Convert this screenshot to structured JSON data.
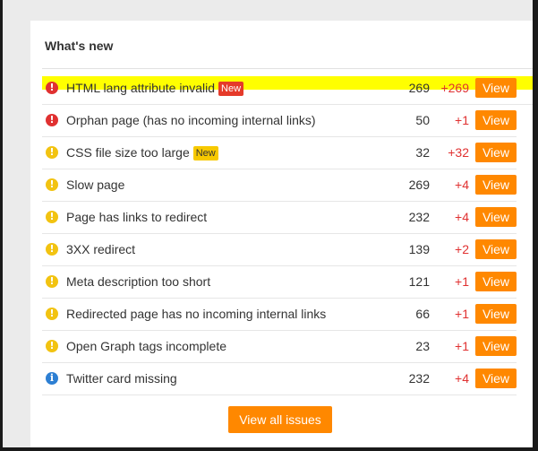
{
  "panel": {
    "title": "What's new"
  },
  "issues": [
    {
      "severity": "error",
      "icon": "!",
      "name": "HTML lang attribute invalid",
      "badge": "New",
      "badge_color": "red",
      "count": "269",
      "delta": "+269",
      "view_label": "View",
      "highlighted": true
    },
    {
      "severity": "error",
      "icon": "!",
      "name": "Orphan page (has no incoming internal links)",
      "badge": "",
      "count": "50",
      "delta": "+1",
      "view_label": "View"
    },
    {
      "severity": "warning",
      "icon": "!",
      "name": "CSS file size too large",
      "badge": "New",
      "badge_color": "yellow",
      "count": "32",
      "delta": "+32",
      "view_label": "View"
    },
    {
      "severity": "warning",
      "icon": "!",
      "name": "Slow page",
      "badge": "",
      "count": "269",
      "delta": "+4",
      "view_label": "View"
    },
    {
      "severity": "warning",
      "icon": "!",
      "name": "Page has links to redirect",
      "badge": "",
      "count": "232",
      "delta": "+4",
      "view_label": "View"
    },
    {
      "severity": "warning",
      "icon": "!",
      "name": "3XX redirect",
      "badge": "",
      "count": "139",
      "delta": "+2",
      "view_label": "View"
    },
    {
      "severity": "warning",
      "icon": "!",
      "name": "Meta description too short",
      "badge": "",
      "count": "121",
      "delta": "+1",
      "view_label": "View"
    },
    {
      "severity": "warning",
      "icon": "!",
      "name": "Redirected page has no incoming internal links",
      "badge": "",
      "count": "66",
      "delta": "+1",
      "view_label": "View"
    },
    {
      "severity": "warning",
      "icon": "!",
      "name": "Open Graph tags incomplete",
      "badge": "",
      "count": "23",
      "delta": "+1",
      "view_label": "View"
    },
    {
      "severity": "notice",
      "icon": "i",
      "name": "Twitter card missing",
      "badge": "",
      "count": "232",
      "delta": "+4",
      "view_label": "View"
    }
  ],
  "footer": {
    "view_all_label": "View all issues"
  },
  "colors": {
    "accent": "#ff8800",
    "highlight": "#ffff00",
    "error": "#e03131",
    "warning": "#f2c311",
    "notice": "#2d7fd3",
    "delta": "#e03131"
  }
}
